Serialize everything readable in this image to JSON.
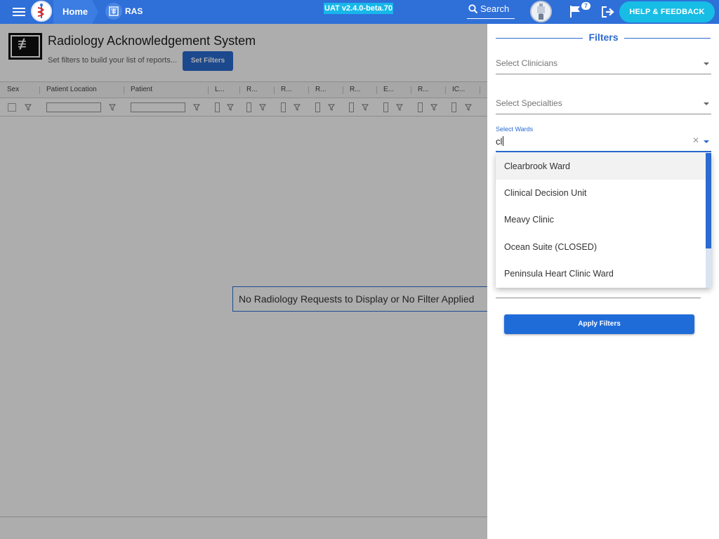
{
  "header": {
    "home_label": "Home",
    "app_label": "RAS",
    "version": "UAT v2.4.0-beta.70",
    "search_label": "Search",
    "notifications_count": "7",
    "help_label": "HELP & FEEDBACK"
  },
  "main": {
    "title": "Radiology Acknowledgement System",
    "subtitle": "Set filters to build your list of reports...",
    "set_filters_label": "Set Filters",
    "columns": [
      "Sex",
      "Patient Location",
      "Patient",
      "L...",
      "R...",
      "R...",
      "R...",
      "R...",
      "E...",
      "R...",
      "IC..."
    ],
    "empty_message": "No Radiology Requests to Display or No Filter Applied"
  },
  "filters": {
    "title": "Filters",
    "clinicians_placeholder": "Select Clinicians",
    "specialties_placeholder": "Select Specialties",
    "wards_label": "Select Wards",
    "wards_value": "cl",
    "ward_options": [
      "Clearbrook Ward",
      "Clinical Decision Unit",
      "Meavy Clinic",
      "Ocean Suite (CLOSED)",
      "Peninsula Heart Clinic Ward"
    ],
    "apply_label": "Apply Filters"
  },
  "colors": {
    "primary": "#2f6fd8",
    "accent": "#17bde4",
    "button": "#1f6cd9"
  }
}
